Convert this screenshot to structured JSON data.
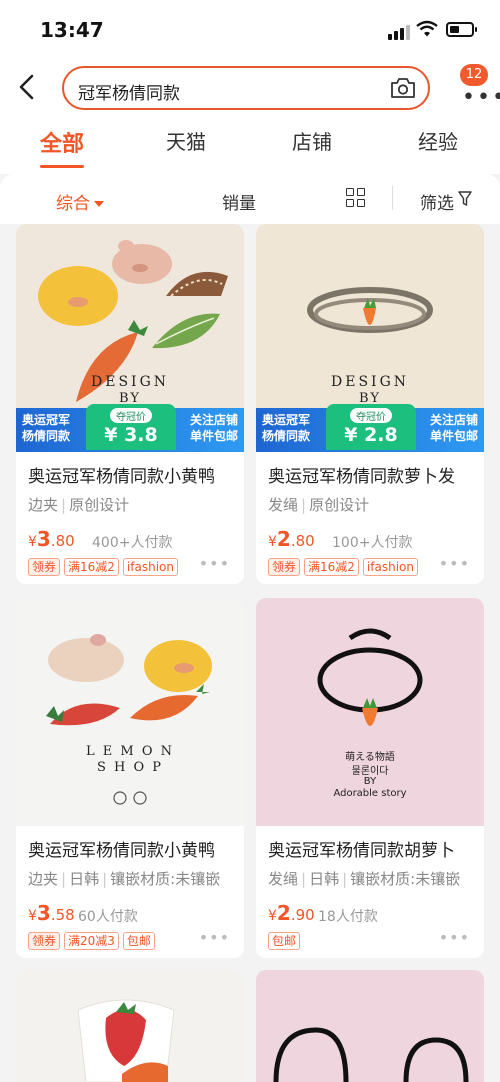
{
  "status_bar": {
    "time": "13:47"
  },
  "header": {
    "search_query": "冠军杨倩同款",
    "badge_count": "12"
  },
  "tabs": [
    {
      "label": "全部",
      "active": true
    },
    {
      "label": "天猫"
    },
    {
      "label": "店铺"
    },
    {
      "label": "经验"
    }
  ],
  "filters": {
    "sort": "综合",
    "sales": "销量",
    "filter": "筛选"
  },
  "products": [
    {
      "title": "奥运冠军杨倩同款小黄鸭",
      "attrs": [
        "边夹",
        "原创设计"
      ],
      "currency": "¥",
      "price_int": "3",
      "price_dec": ".80",
      "sold": "400+人付款",
      "tags": [
        "领券",
        "满16减2",
        "ifashion"
      ],
      "img_text": [
        "DESIGN",
        "BY"
      ],
      "banner": {
        "left": "奥运冠军\n杨倩同款",
        "mid_label": "夺冠价",
        "mid_value": "¥ 3.8",
        "right": "关注店铺\n单件包邮"
      }
    },
    {
      "title": "奥运冠军杨倩同款萝卜发",
      "attrs": [
        "发绳",
        "原创设计"
      ],
      "currency": "¥",
      "price_int": "2",
      "price_dec": ".80",
      "sold": "100+人付款",
      "tags": [
        "领券",
        "满16减2",
        "ifashion"
      ],
      "img_text": [
        "DESIGN",
        "BY"
      ],
      "banner": {
        "left": "奥运冠军\n杨倩同款",
        "mid_label": "夺冠价",
        "mid_value": "¥ 2.8",
        "right": "关注店铺\n单件包邮"
      }
    },
    {
      "title": "奥运冠军杨倩同款小黄鸭",
      "attrs": [
        "边夹",
        "日韩",
        "镶嵌材质:未镶嵌"
      ],
      "currency": "¥",
      "price_int": "3",
      "price_dec": ".58",
      "sold": "60人付款",
      "tags": [
        "领券",
        "满20减3",
        "包邮"
      ],
      "img_text": [
        "L E M O N",
        "S H O P"
      ]
    },
    {
      "title": "奥运冠军杨倩同款胡萝卜",
      "attrs": [
        "发绳",
        "日韩",
        "镶嵌材质:未镶嵌"
      ],
      "currency": "¥",
      "price_int": "2",
      "price_dec": ".90",
      "sold": "18人付款",
      "tags": [
        "包邮"
      ],
      "img_text": [
        "萌える物語",
        "물론이다",
        "BY",
        "Adorable story"
      ]
    }
  ],
  "colors": {
    "accent": "#f35527",
    "bg": "#f3f3f3"
  }
}
